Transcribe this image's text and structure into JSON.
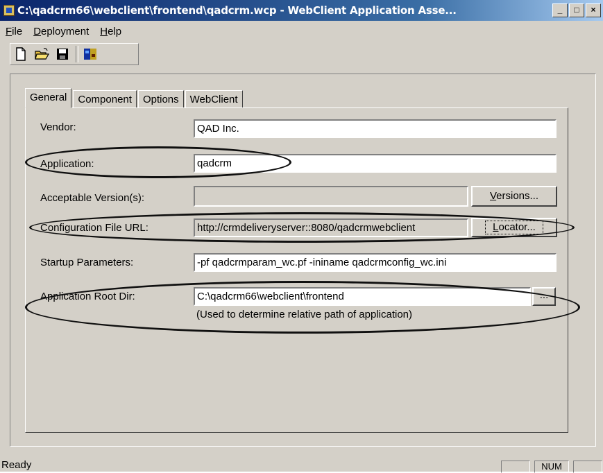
{
  "window": {
    "title": "C:\\qadcrm66\\webclient\\frontend\\qadcrm.wcp - WebClient Application Asse...",
    "minimize": "_",
    "maximize": "□",
    "close": "×"
  },
  "menu": [
    {
      "first": "F",
      "rest": "ile"
    },
    {
      "first": "D",
      "rest": "eployment"
    },
    {
      "first": "H",
      "rest": "elp"
    }
  ],
  "toolbar": {
    "icons": [
      "new-file-icon",
      "open-folder-icon",
      "save-disk-icon",
      "deploy-icon"
    ]
  },
  "tabs": [
    "General",
    "Component",
    "Options",
    "WebClient"
  ],
  "form": {
    "vendor_label": "Vendor:",
    "vendor_value": "QAD Inc.",
    "application_label": "Application:",
    "application_value": "qadcrm",
    "versions_label": "Acceptable Version(s):",
    "versions_value": "",
    "versions_button_first": "V",
    "versions_button_rest": "ersions...",
    "config_label": "Configuration File URL:",
    "config_value": "http://crmdeliveryserver::8080/qadcrmwebclient",
    "locator_button_first": "L",
    "locator_button_rest": "ocator...",
    "startup_label": "Startup Parameters:",
    "startup_value": "-pf qadcrmparam_wc.pf -ininame qadcrmconfig_wc.ini",
    "rootdir_label": "Application Root Dir:",
    "rootdir_value": "C:\\qadcrm66\\webclient\\frontend",
    "rootdir_browse": "...",
    "rootdir_note": "(Used to determine relative path of application)"
  },
  "status": {
    "text": "Ready",
    "num": "NUM"
  },
  "colors": {
    "title_gradient_start": "#0a246a",
    "title_gradient_end": "#a6caf0",
    "face": "#d4d0c8"
  }
}
